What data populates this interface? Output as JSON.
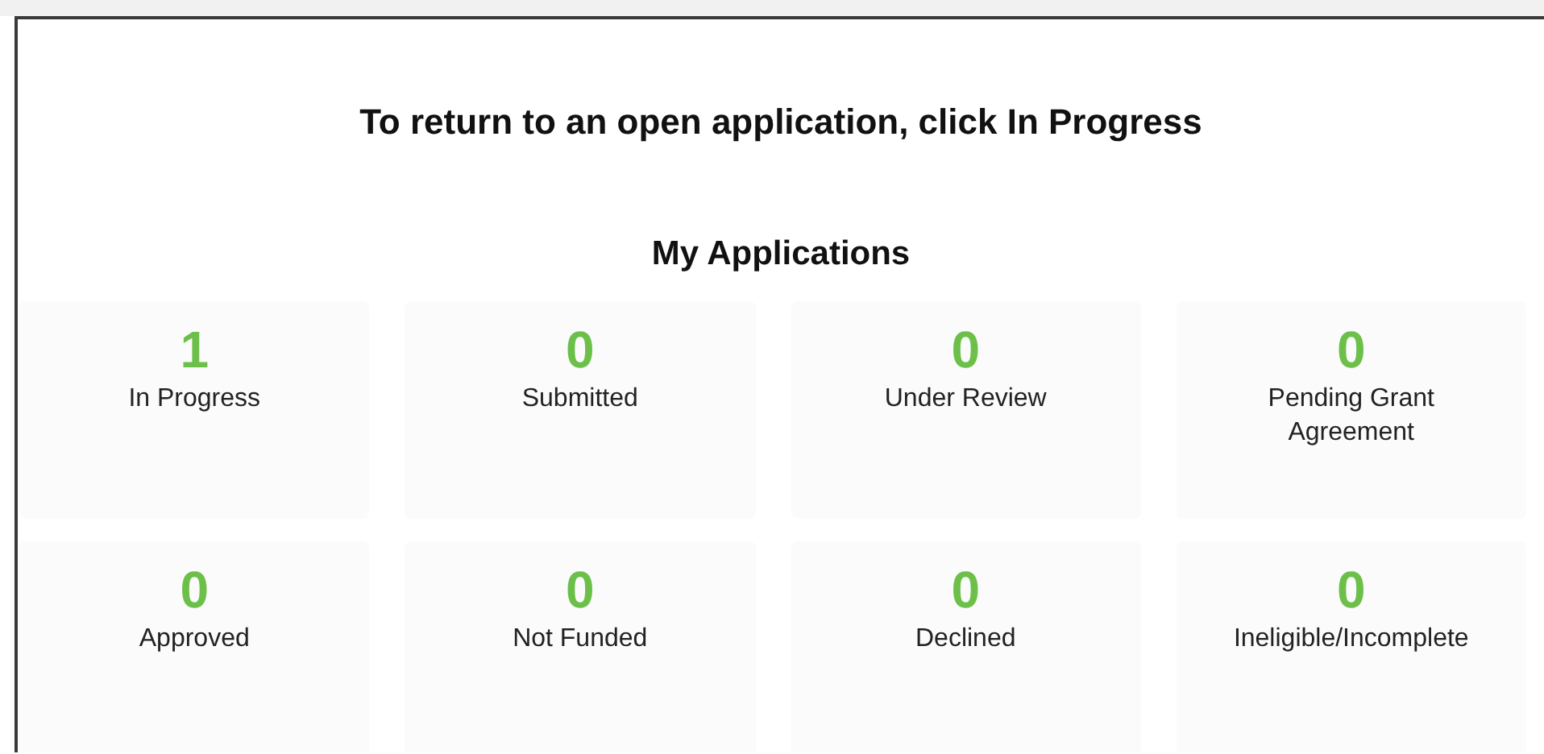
{
  "instruction": "To return to an open application, click In Progress",
  "heading": "My Applications",
  "statuses": [
    {
      "count": "1",
      "label": "In Progress"
    },
    {
      "count": "0",
      "label": "Submitted"
    },
    {
      "count": "0",
      "label": "Under Review"
    },
    {
      "count": "0",
      "label": "Pending Grant Agreement"
    },
    {
      "count": "0",
      "label": "Approved"
    },
    {
      "count": "0",
      "label": "Not Funded"
    },
    {
      "count": "0",
      "label": "Declined"
    },
    {
      "count": "0",
      "label": "Ineligible/Incomplete"
    }
  ]
}
